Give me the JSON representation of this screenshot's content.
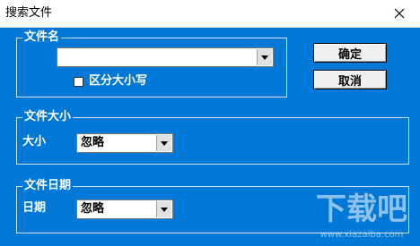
{
  "window": {
    "title": "搜索文件"
  },
  "filename_group": {
    "legend": "文件名",
    "value": "",
    "case_checkbox_label": "区分大小写",
    "case_checked": false
  },
  "size_group": {
    "legend": "文件大小",
    "label": "大小",
    "value": "忽略"
  },
  "date_group": {
    "legend": "文件日期",
    "label": "日期",
    "value": "忽略"
  },
  "buttons": {
    "ok": "确定",
    "cancel": "取消"
  },
  "watermark": {
    "text": "下载吧",
    "url": "www.xiazaiba.com"
  }
}
